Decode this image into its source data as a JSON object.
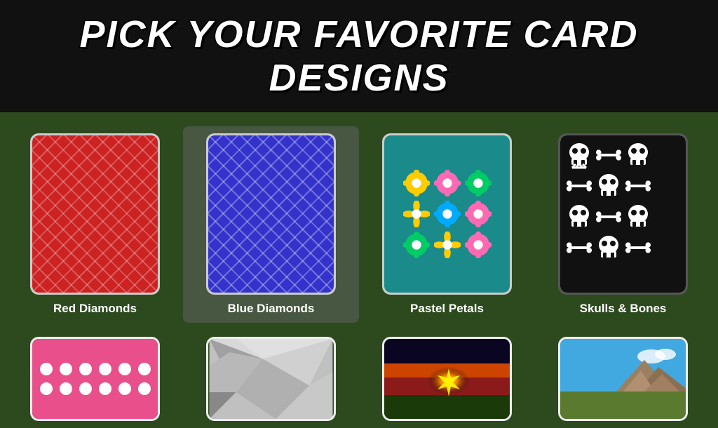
{
  "header": {
    "title": "PICK YOUR FAVORITE CARD DESIGNS",
    "background": "#111111"
  },
  "cards": [
    {
      "id": "red-diamonds",
      "label": "Red Diamonds",
      "selected": false,
      "type": "pattern-diamonds-red"
    },
    {
      "id": "blue-diamonds",
      "label": "Blue Diamonds",
      "selected": true,
      "type": "pattern-diamonds-blue"
    },
    {
      "id": "pastel-petals",
      "label": "Pastel Petals",
      "selected": false,
      "type": "pattern-flowers"
    },
    {
      "id": "skulls-bones",
      "label": "Skulls & Bones",
      "selected": false,
      "type": "pattern-skulls"
    }
  ],
  "bottom_cards": [
    {
      "id": "pink-dots",
      "label": "",
      "type": "pattern-pink-dots"
    },
    {
      "id": "geometric",
      "label": "",
      "type": "pattern-geo"
    },
    {
      "id": "sunset",
      "label": "",
      "type": "photo-sunset"
    },
    {
      "id": "landscape",
      "label": "",
      "type": "photo-landscape"
    }
  ],
  "flowers": [
    {
      "color": "#ffcc00",
      "petals": "#ffcc00"
    },
    {
      "color": "#ff69b4",
      "petals": "#ff69b4"
    },
    {
      "color": "#00cc66",
      "petals": "#00cc66"
    },
    {
      "color": "#ffcc00",
      "petals": "#ffcc00"
    },
    {
      "color": "#00aaff",
      "petals": "#00aaff"
    },
    {
      "color": "#ff69b4",
      "petals": "#ff69b4"
    },
    {
      "color": "#00cc66",
      "petals": "#00cc66"
    },
    {
      "color": "#ffcc00",
      "petals": "#ffcc00"
    },
    {
      "color": "#ff69b4",
      "petals": "#ff69b4"
    },
    {
      "color": "#00cc66",
      "petals": "#00cc66"
    },
    {
      "color": "#ffcc00",
      "petals": "#ffcc00"
    },
    {
      "color": "#00aaff",
      "petals": "#00aaff"
    }
  ]
}
